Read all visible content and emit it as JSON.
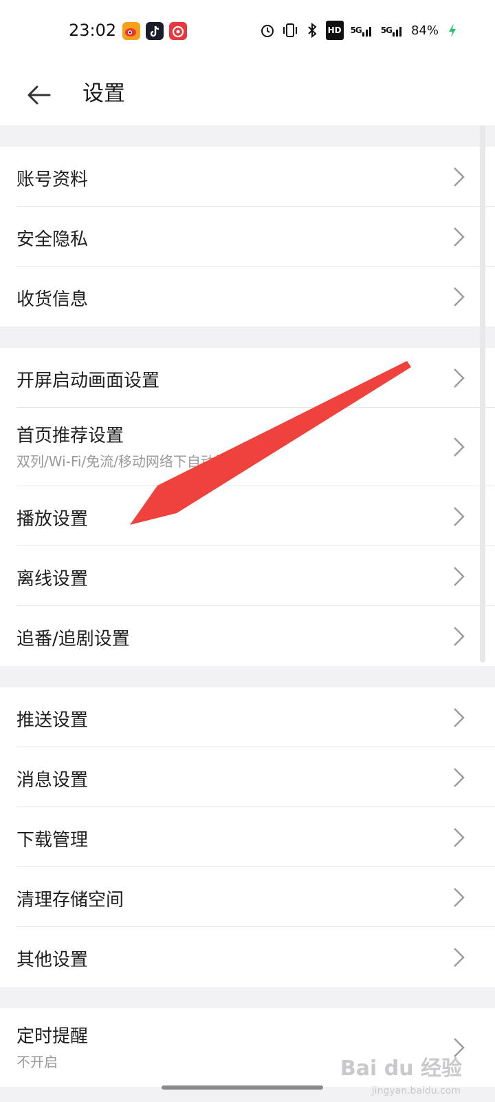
{
  "status_bar": {
    "time": "23:02",
    "apps": [
      {
        "icon": "weibo-icon",
        "color": "#f4a11c"
      },
      {
        "icon": "tiktok-icon",
        "color": "#1b1b2b"
      },
      {
        "icon": "netease-music-icon",
        "color": "#e8383d"
      }
    ],
    "right_icons": [
      "alarm-icon",
      "vibrate-icon",
      "bluetooth-icon"
    ],
    "hd_label": "HD",
    "signal1_label": "5G",
    "signal2_label": "5G",
    "battery_percent": "84%"
  },
  "app_bar": {
    "title": "设置"
  },
  "groups": [
    [
      {
        "label": "账号资料"
      },
      {
        "label": "安全隐私"
      },
      {
        "label": "收货信息"
      }
    ],
    [
      {
        "label": "开屏启动画面设置"
      },
      {
        "label": "首页推荐设置",
        "sub": "双列/Wi-Fi/免流/移动网络下自动播放"
      },
      {
        "label": "播放设置"
      },
      {
        "label": "离线设置"
      },
      {
        "label": "追番/追剧设置"
      }
    ],
    [
      {
        "label": "推送设置"
      },
      {
        "label": "消息设置"
      },
      {
        "label": "下载管理"
      },
      {
        "label": "清理存储空间"
      },
      {
        "label": "其他设置"
      }
    ],
    [
      {
        "label": "定时提醒",
        "sub": "不开启"
      }
    ]
  ],
  "annotation": {
    "color": "#f0423c"
  },
  "watermark": {
    "text": "Bai du 经验",
    "sub": "jingyan.baidu.com"
  }
}
